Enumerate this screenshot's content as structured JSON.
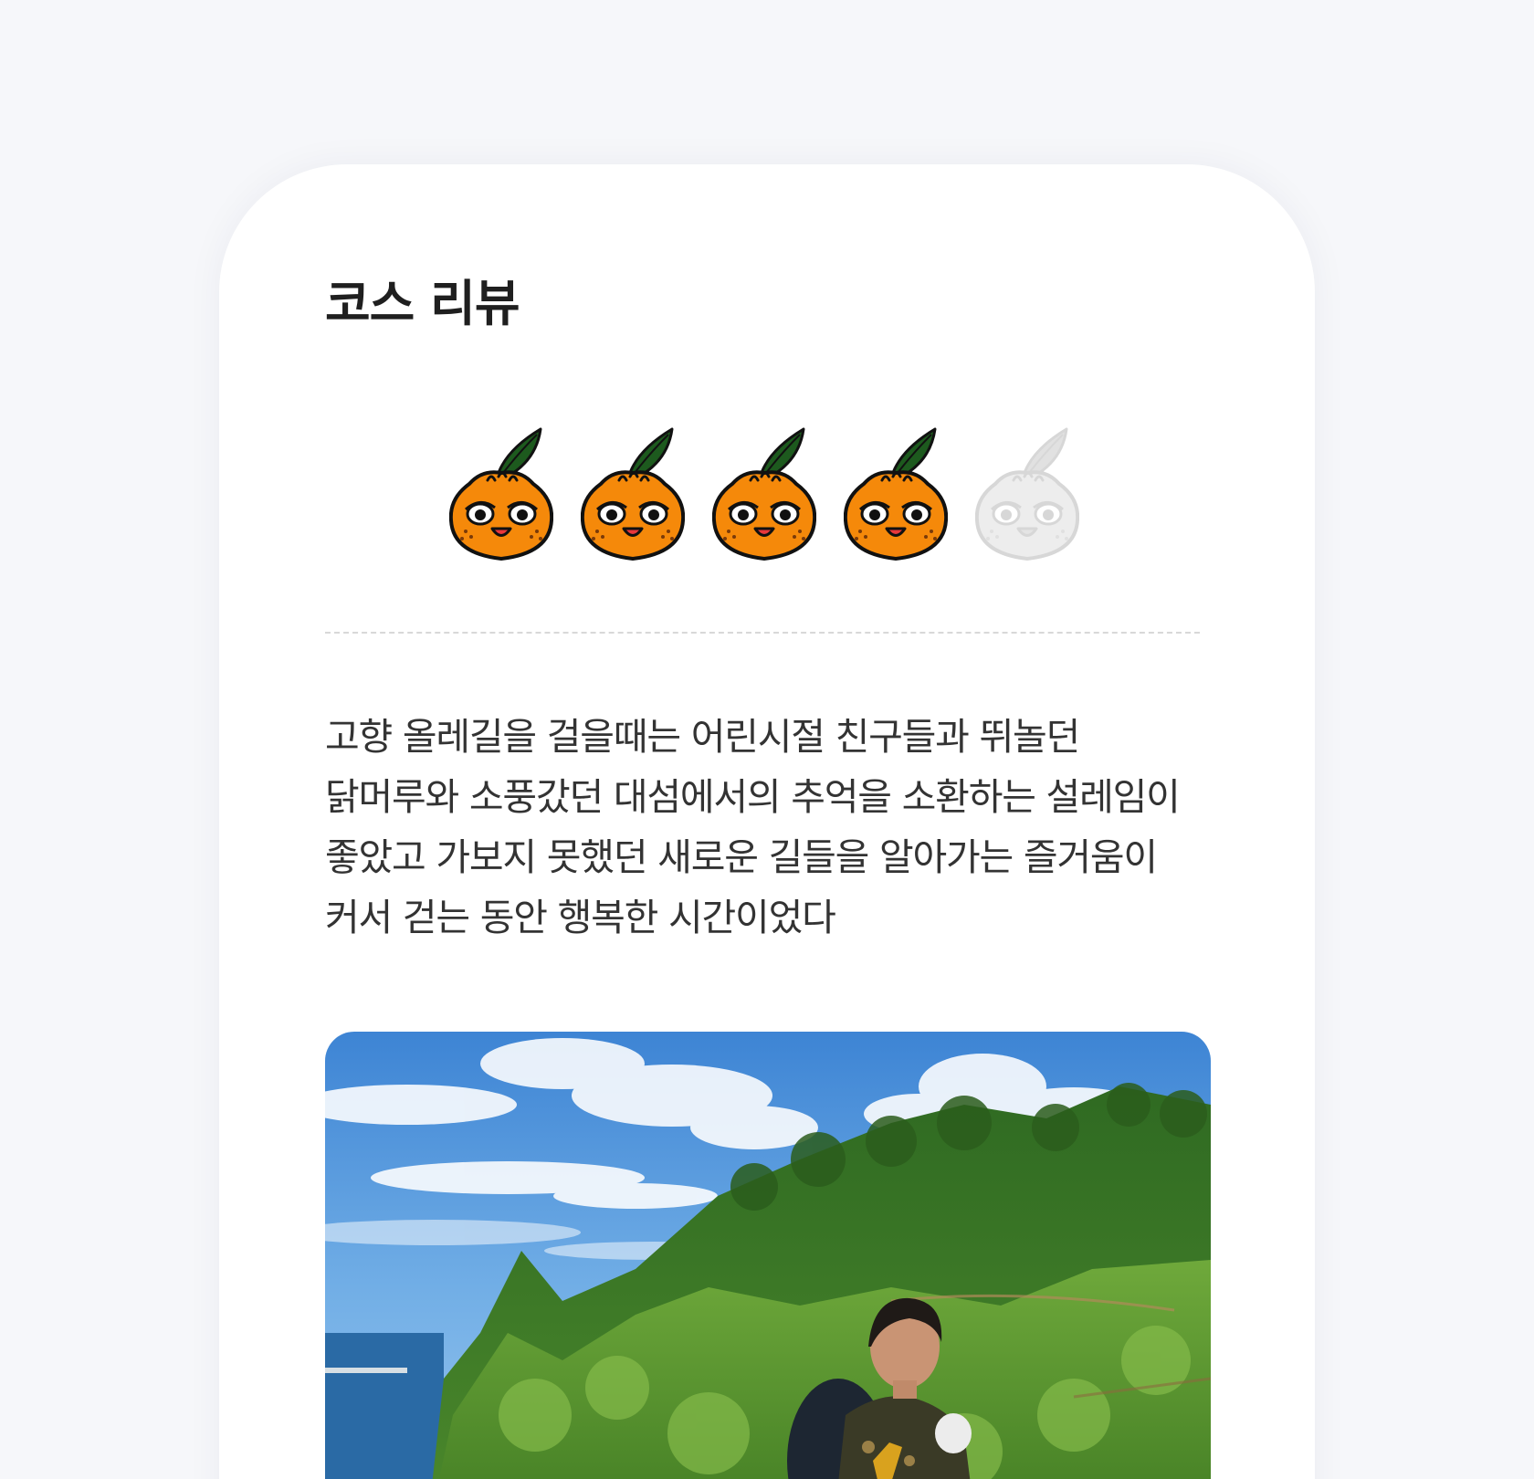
{
  "review": {
    "title": "코스 리뷰",
    "rating": 4,
    "rating_max": 5,
    "rating_icon": "tangerine-character-icon",
    "text": "고향 올레길을 걸을때는 어린시절 친구들과 뛰놀던 닭머루와 소풍갔던 대섬에서의 추억을 소환하는 설레임이 좋았고 가보지 못했던 새로운 길들을 알아가는 즐거움이 커서 걷는 동안 행복한 시간이었다"
  },
  "colors": {
    "background": "#f6f7fa",
    "card": "#ffffff",
    "tangerine": "#f5890a",
    "leaf": "#1d5a1e",
    "title_text": "#1f1f1f",
    "body_text": "#333333"
  }
}
